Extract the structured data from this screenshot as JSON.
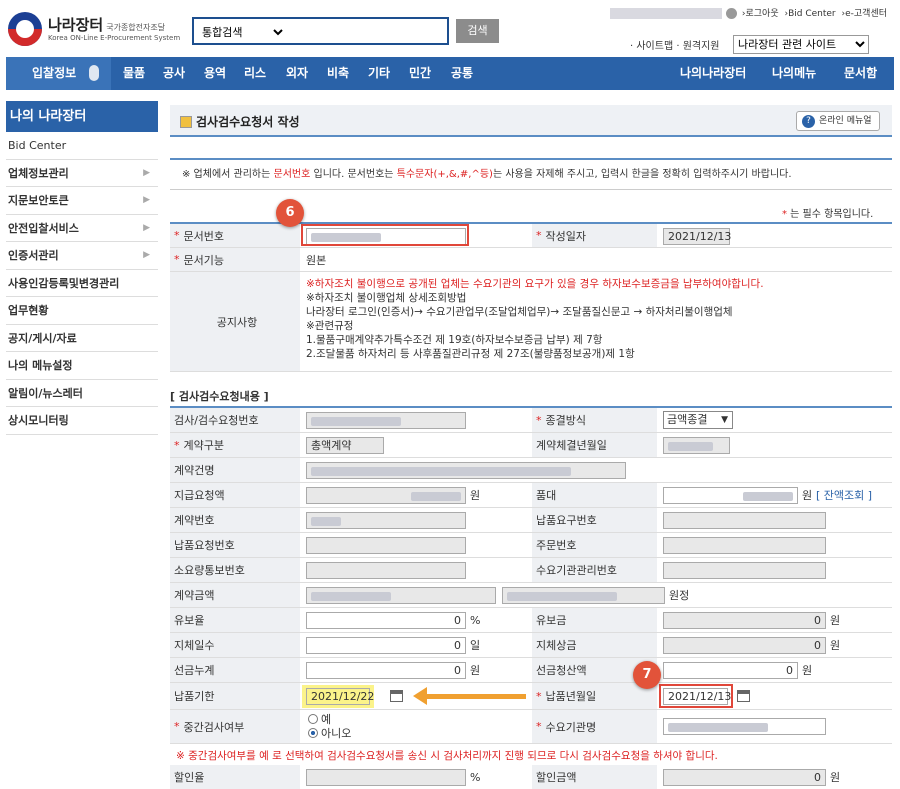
{
  "header": {
    "logo_title": "나라장터",
    "logo_title_small": "국가종합전자조달",
    "logo_sub": "Korea ON-Line E-Procurement System",
    "search_select": "통합검색",
    "search_btn": "검색",
    "top_links": [
      "›로그아웃",
      "›Bid Center",
      "›e-고객센터"
    ],
    "site_map": "· 사이트맵 · 원격지원",
    "site_select": "나라장터 관련 사이트"
  },
  "nav": {
    "bid": "입찰정보",
    "items": [
      "물품",
      "공사",
      "용역",
      "리스",
      "외자",
      "비축",
      "기타",
      "민간",
      "공통"
    ],
    "right_items": [
      "나의나라장터",
      "나의메뉴",
      "문서함"
    ]
  },
  "sidebar": {
    "title": "나의 나라장터",
    "items": [
      "Bid Center",
      "업체정보관리",
      "지문보안토큰",
      "안전입찰서비스",
      "인증서관리",
      "사용인감등록및변경관리",
      "업무현황",
      "공지/게시/자료",
      "나의 메뉴설정",
      "알림이/뉴스레터",
      "상시모니터링"
    ]
  },
  "page": {
    "title": "검사검수요청서 작성",
    "manual_btn": "온라인 메뉴얼",
    "notice_prefix": "※ 업체에서 관리하는 ",
    "notice_doc": "문서번호",
    "notice_mid1": " 입니다. 문서번호는 ",
    "notice_special": "특수문자(+,&,#,^등)",
    "notice_mid2": "는 사용을 자제해 주시고, 입력시 한글을 정확히 입력하주시기 바랍니다.",
    "req_note_star": "*",
    "req_note": " 는 필수 항목입니다."
  },
  "form1": {
    "doc_no_label": "문서번호",
    "date_label": "작성일자",
    "date_value": "2021/12/13",
    "doc_func_label": "문서기능",
    "doc_func_value": "원본",
    "notice_label": "공지사항",
    "notice_lines": [
      "※하자조치 불이행으로 공개된 업체는 수요기관의 요구가 있을 경우 하자보수보증금을 납부하여야합니다.",
      "※하자조치 불이행업체 상세조회방법",
      "나라장터 로그인(인증서)→ 수요기관업무(조달업체업무)→ 조달품질신문고 → 하자처리불이행업체",
      "※관련규정",
      "1.물품구매계약추가특수조건 제 19호(하자보수보증금 납부) 제 7항",
      "2.조달물품 하자처리 등 사후품질관리규정 제 27조(불량품정보공개)제 1항"
    ]
  },
  "section_title": "[ 검사검수요청내용 ]",
  "form2": {
    "insp_no_label": "검사/검수요청번호",
    "completion_label": "종결방식",
    "completion_value": "금액종결",
    "contract_type_label": "계약구분",
    "contract_type_value": "총액계약",
    "contract_date_label": "계약체결년월일",
    "contract_name_label": "계약건명",
    "payment_label": "지급요청액",
    "won": "원",
    "item_price_label": "품대",
    "balance_link": "[ 잔액조회 ]",
    "contract_no_label": "계약번호",
    "delivery_req_no_label": "납품요구번호",
    "delivery_req_no2_label": "납품요청번호",
    "order_no_label": "주문번호",
    "consumption_label": "소요량통보번호",
    "agency_mgmt_label": "수요기관관리번호",
    "contract_amount_label": "계약금액",
    "won_full": "원정",
    "reserve_rate_label": "유보율",
    "reserve_rate_value": "0",
    "percent": "%",
    "reserve_amt_label": "유보금",
    "reserve_amt_value": "0",
    "delay_days_label": "지체일수",
    "delay_days_value": "0",
    "day_unit": "일",
    "delay_penalty_label": "지체상금",
    "delay_penalty_value": "0",
    "advance_label": "선금누계",
    "advance_value": "0",
    "advance_settle_label": "선금청산액",
    "advance_settle_value": "0",
    "deadline_label": "납품기한",
    "deadline_value": "2021/12/22",
    "delivery_date_label": "납품년월일",
    "delivery_date_value": "2021/12/13",
    "interim_label": "중간검사여부",
    "radio_yes": "예",
    "radio_no": "아니오",
    "agency_name_label": "수요기관명",
    "red_note": "※ 중간검사여부를 예 로 선택하여 검사검수요청서를 송신 시 검사처리까지 진행 되므로 다시 검사검수요청을 하셔야 합니다.",
    "discount_rate_label": "할인율",
    "discount_amt_label": "할인금액",
    "discount_amt_value": "0"
  },
  "badges": {
    "b6": "6",
    "b7": "7"
  },
  "colors": {
    "nav": "#2a62a8",
    "accent_red": "#e0473a",
    "highlight_yellow": "#fbf38a",
    "arrow": "#f0a030"
  }
}
